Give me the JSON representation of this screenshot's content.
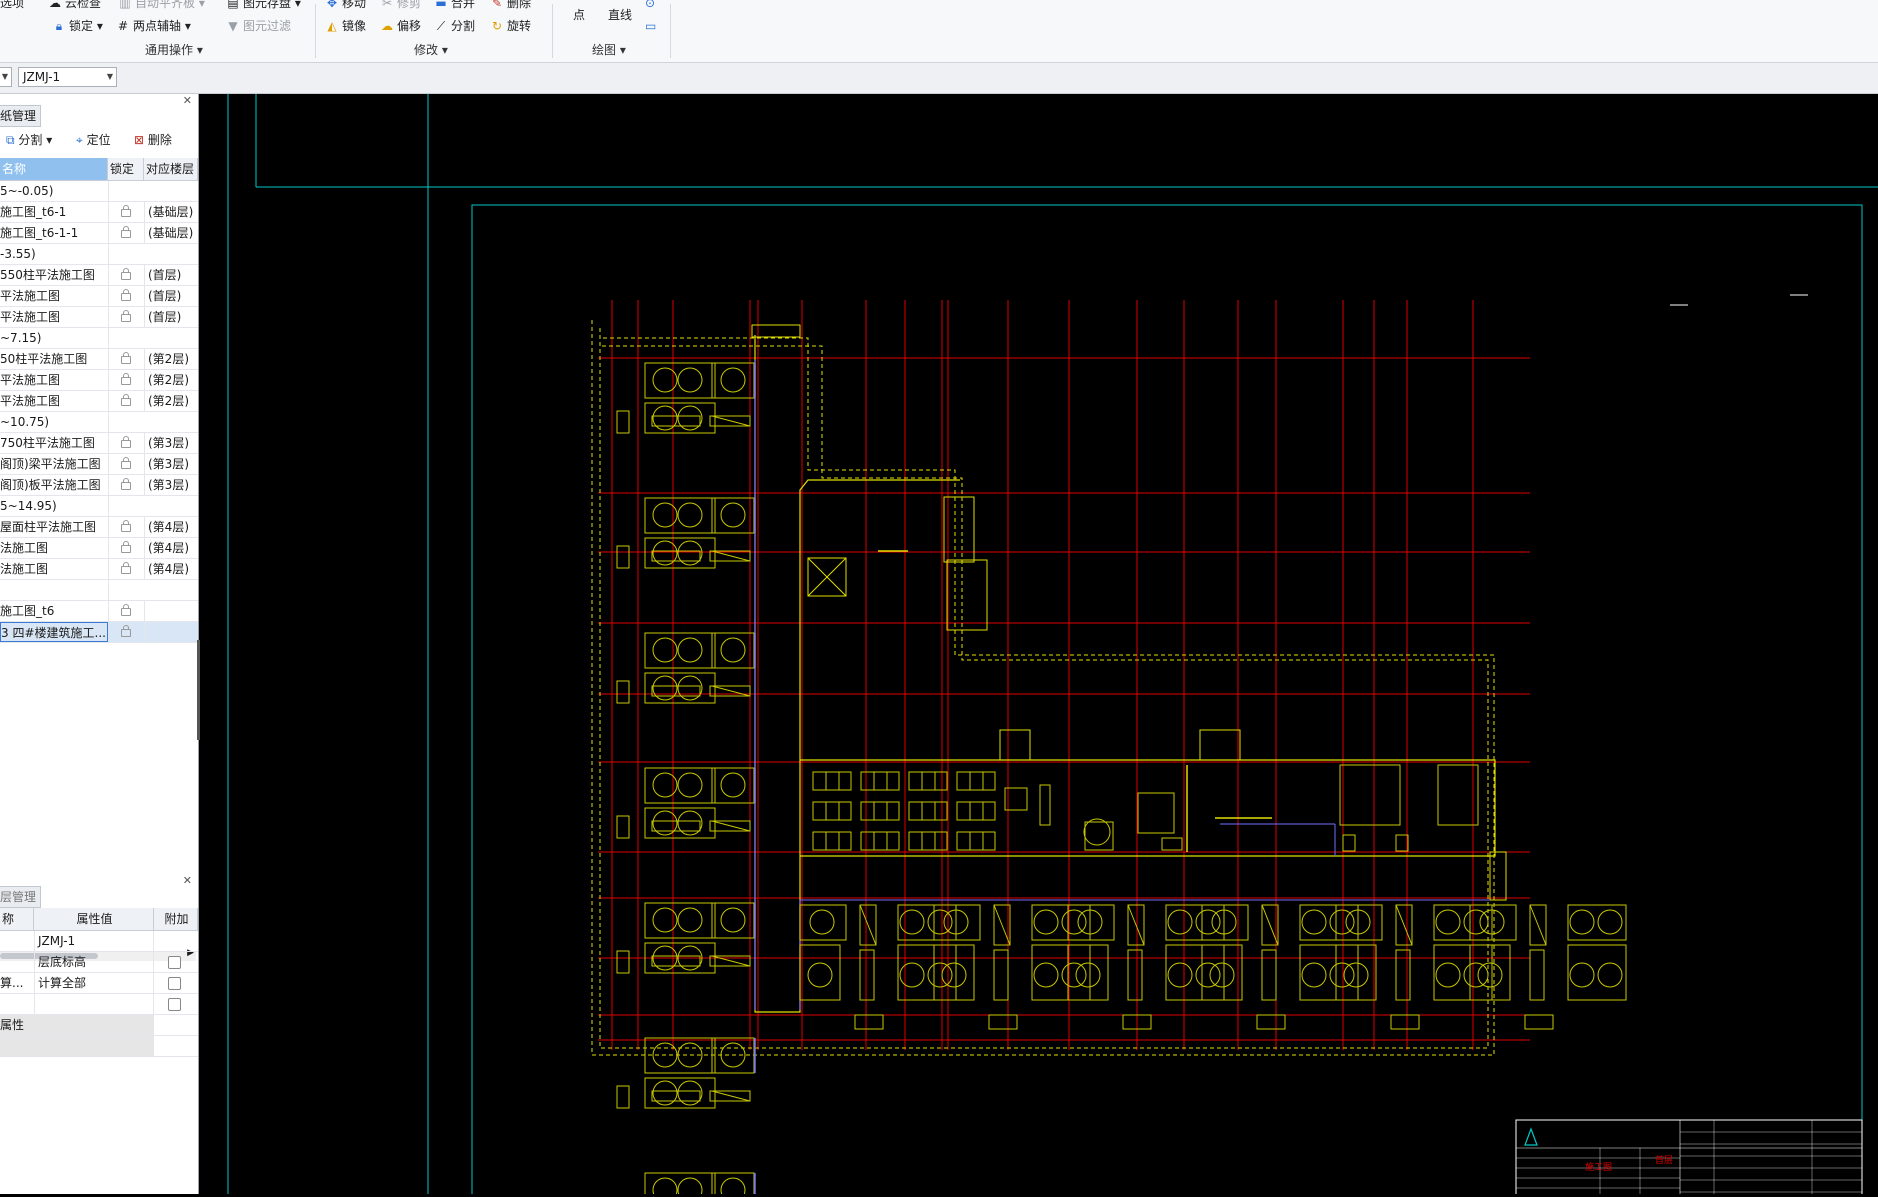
{
  "ribbon": {
    "groups": [
      {
        "label": "通用操作",
        "buttons": [
          "云检查",
          "自动平齐板",
          "锁定",
          "两点辅轴",
          "图元存盘",
          "图元过滤"
        ]
      },
      {
        "label": "修改",
        "buttons": [
          "移动",
          "修剪",
          "合并",
          "删除",
          "镜像",
          "偏移",
          "分割",
          "旋转"
        ]
      },
      {
        "label": "绘图",
        "buttons": [
          "点",
          "直线"
        ]
      }
    ],
    "left_cut": "选项"
  },
  "toolbar2": {
    "floor_combo": "",
    "component_combo": "JZMJ-1"
  },
  "drawing_panel": {
    "title": "纸管理",
    "tools": [
      "分割",
      "定位",
      "删除"
    ],
    "columns": [
      "名称",
      "锁定",
      "对应楼层"
    ],
    "rows": [
      {
        "name": "5~-0.05)",
        "group": true,
        "floor": ""
      },
      {
        "name": "施工图_t6-1",
        "floor": "(基础层)"
      },
      {
        "name": "施工图_t6-1-1",
        "floor": "(基础层)"
      },
      {
        "name": "-3.55)",
        "group": true,
        "floor": ""
      },
      {
        "name": "550柱平法施工图",
        "floor": "(首层)"
      },
      {
        "name": "平法施工图",
        "floor": "(首层)"
      },
      {
        "name": "平法施工图",
        "floor": "(首层)"
      },
      {
        "name": "~7.15)",
        "group": true,
        "floor": ""
      },
      {
        "name": "50柱平法施工图",
        "floor": "(第2层)"
      },
      {
        "name": "平法施工图",
        "floor": "(第2层)"
      },
      {
        "name": "平法施工图",
        "floor": "(第2层)"
      },
      {
        "name": "~10.75)",
        "group": true,
        "floor": ""
      },
      {
        "name": "750柱平法施工图",
        "floor": "(第3层)"
      },
      {
        "name": "阁顶)梁平法施工图",
        "floor": "(第3层)"
      },
      {
        "name": "阁顶)板平法施工图",
        "floor": "(第3层)"
      },
      {
        "name": "5~14.95)",
        "group": true,
        "floor": ""
      },
      {
        "name": "屋面柱平法施工图",
        "floor": "(第4层)"
      },
      {
        "name": "法施工图",
        "floor": "(第4层)"
      },
      {
        "name": "法施工图",
        "floor": "(第4层)"
      },
      {
        "name": "",
        "group": true,
        "floor": ""
      },
      {
        "name": "施工图_t6",
        "floor": ""
      },
      {
        "name": "3 四#楼建筑施工...",
        "floor": "",
        "selected": true
      }
    ]
  },
  "property_panel": {
    "title": "层管理",
    "columns": [
      "称",
      "属性值",
      "附加"
    ],
    "rows": [
      {
        "name": "",
        "value": "JZMJ-1",
        "check": false
      },
      {
        "name": "",
        "value": "层底标高",
        "check": true
      },
      {
        "name": "算...",
        "value": "计算全部",
        "check": true
      },
      {
        "name": "",
        "value": "",
        "check": true
      },
      {
        "name": "属性",
        "value": "",
        "grey": true
      },
      {
        "name": "",
        "value": "",
        "grey": true
      }
    ]
  },
  "cad": {
    "colors": {
      "frame": "#00c8c8",
      "grid": "#e00000",
      "wall": "#e0e000",
      "furniture": "#c8c800",
      "blue": "#7070ff"
    },
    "title_block_marks": [
      "施工图",
      "首层"
    ]
  }
}
